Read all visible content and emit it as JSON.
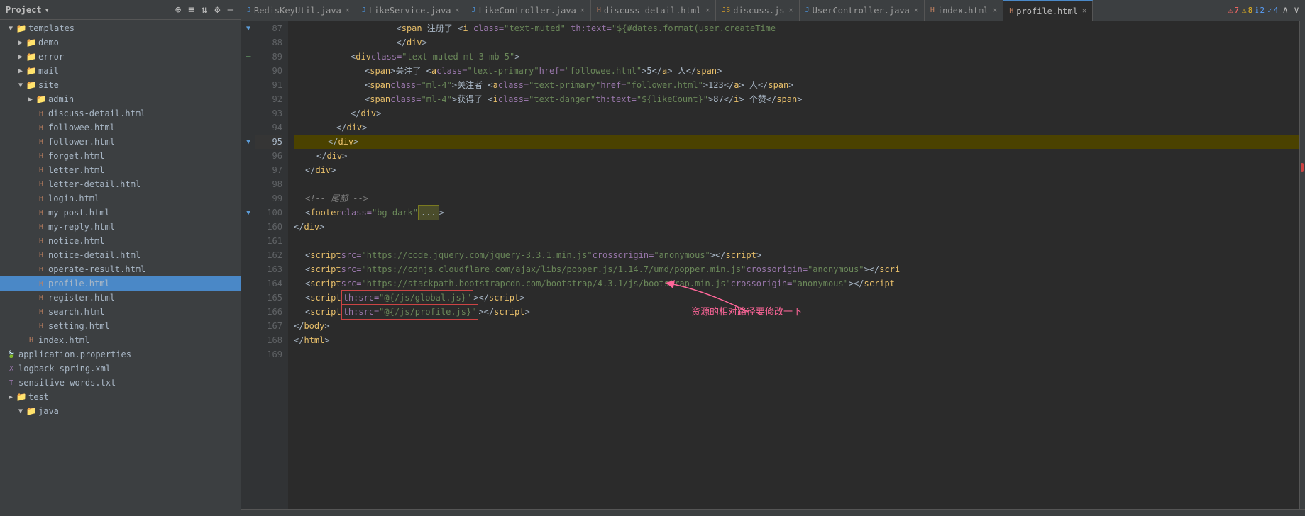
{
  "sidebar": {
    "header": "Project",
    "header_icon": "▾",
    "icons": [
      "⊕",
      "≡",
      "⇅",
      "⚙",
      "—"
    ],
    "tree": [
      {
        "id": "templates",
        "label": "templates",
        "level": 1,
        "type": "folder",
        "open": true,
        "arrow": "▼"
      },
      {
        "id": "demo",
        "label": "demo",
        "level": 2,
        "type": "folder",
        "open": false,
        "arrow": "▶"
      },
      {
        "id": "error",
        "label": "error",
        "level": 2,
        "type": "folder",
        "open": false,
        "arrow": "▶"
      },
      {
        "id": "mail",
        "label": "mail",
        "level": 2,
        "type": "folder",
        "open": false,
        "arrow": "▶"
      },
      {
        "id": "site",
        "label": "site",
        "level": 2,
        "type": "folder",
        "open": true,
        "arrow": "▼"
      },
      {
        "id": "admin",
        "label": "admin",
        "level": 3,
        "type": "folder",
        "open": false,
        "arrow": "▶"
      },
      {
        "id": "discuss-detail.html",
        "label": "discuss-detail.html",
        "level": 3,
        "type": "html"
      },
      {
        "id": "followee.html",
        "label": "followee.html",
        "level": 3,
        "type": "html"
      },
      {
        "id": "follower.html",
        "label": "follower.html",
        "level": 3,
        "type": "html"
      },
      {
        "id": "forget.html",
        "label": "forget.html",
        "level": 3,
        "type": "html"
      },
      {
        "id": "letter.html",
        "label": "letter.html",
        "level": 3,
        "type": "html"
      },
      {
        "id": "letter-detail.html",
        "label": "letter-detail.html",
        "level": 3,
        "type": "html"
      },
      {
        "id": "login.html",
        "label": "login.html",
        "level": 3,
        "type": "html"
      },
      {
        "id": "my-post.html",
        "label": "my-post.html",
        "level": 3,
        "type": "html"
      },
      {
        "id": "my-reply.html",
        "label": "my-reply.html",
        "level": 3,
        "type": "html"
      },
      {
        "id": "notice.html",
        "label": "notice.html",
        "level": 3,
        "type": "html"
      },
      {
        "id": "notice-detail.html",
        "label": "notice-detail.html",
        "level": 3,
        "type": "html"
      },
      {
        "id": "operate-result.html",
        "label": "operate-result.html",
        "level": 3,
        "type": "html"
      },
      {
        "id": "profile.html",
        "label": "profile.html",
        "level": 3,
        "type": "html",
        "selected": true
      },
      {
        "id": "register.html",
        "label": "register.html",
        "level": 3,
        "type": "html"
      },
      {
        "id": "search.html",
        "label": "search.html",
        "level": 3,
        "type": "html"
      },
      {
        "id": "setting.html",
        "label": "setting.html",
        "level": 3,
        "type": "html"
      },
      {
        "id": "index.html-site",
        "label": "index.html",
        "level": 2,
        "type": "html"
      },
      {
        "id": "application.properties",
        "label": "application.properties",
        "level": 1,
        "type": "properties"
      },
      {
        "id": "logback-spring.xml",
        "label": "logback-spring.xml",
        "level": 1,
        "type": "xml"
      },
      {
        "id": "sensitive-words.txt",
        "label": "sensitive-words.txt",
        "level": 1,
        "type": "txt"
      },
      {
        "id": "test",
        "label": "test",
        "level": 0,
        "type": "folder",
        "open": false,
        "arrow": "▶"
      },
      {
        "id": "java",
        "label": "java",
        "level": 1,
        "type": "folder",
        "open": true,
        "arrow": "▼"
      }
    ]
  },
  "tabs": [
    {
      "id": "RedisKeyUtil",
      "label": "RedisKeyUtil.java",
      "type": "java",
      "active": false
    },
    {
      "id": "LikeService",
      "label": "LikeService.java",
      "type": "java",
      "active": false
    },
    {
      "id": "LikeController",
      "label": "LikeController.java",
      "type": "java",
      "active": false
    },
    {
      "id": "discuss-detail",
      "label": "discuss-detail.html",
      "type": "html",
      "active": false
    },
    {
      "id": "discuss",
      "label": "discuss.js",
      "type": "js",
      "active": false
    },
    {
      "id": "UserController",
      "label": "UserController.java",
      "type": "java",
      "active": false
    },
    {
      "id": "index",
      "label": "index.html",
      "type": "html",
      "active": false
    },
    {
      "id": "profile",
      "label": "profile.html",
      "type": "html",
      "active": true
    }
  ],
  "status": {
    "errors": "7",
    "warnings": "8",
    "info1": "2",
    "info2": "4"
  },
  "code": {
    "lines": [
      {
        "num": 87,
        "content": ""
      },
      {
        "num": 88,
        "content": ""
      },
      {
        "num": 89,
        "content": ""
      },
      {
        "num": 90,
        "content": ""
      },
      {
        "num": 91,
        "content": ""
      },
      {
        "num": 92,
        "content": ""
      },
      {
        "num": 93,
        "content": ""
      },
      {
        "num": 94,
        "content": ""
      },
      {
        "num": 95,
        "content": "",
        "highlight": "yellow"
      },
      {
        "num": 96,
        "content": ""
      },
      {
        "num": 97,
        "content": ""
      },
      {
        "num": 98,
        "content": ""
      },
      {
        "num": 99,
        "content": ""
      },
      {
        "num": 100,
        "content": ""
      },
      {
        "num": 160,
        "content": ""
      },
      {
        "num": 161,
        "content": ""
      },
      {
        "num": 162,
        "content": ""
      },
      {
        "num": 163,
        "content": ""
      },
      {
        "num": 164,
        "content": ""
      },
      {
        "num": 165,
        "content": ""
      },
      {
        "num": 166,
        "content": ""
      },
      {
        "num": 167,
        "content": ""
      },
      {
        "num": 168,
        "content": ""
      },
      {
        "num": 169,
        "content": ""
      }
    ],
    "annotation": "资源的相对路径要修改一下"
  }
}
